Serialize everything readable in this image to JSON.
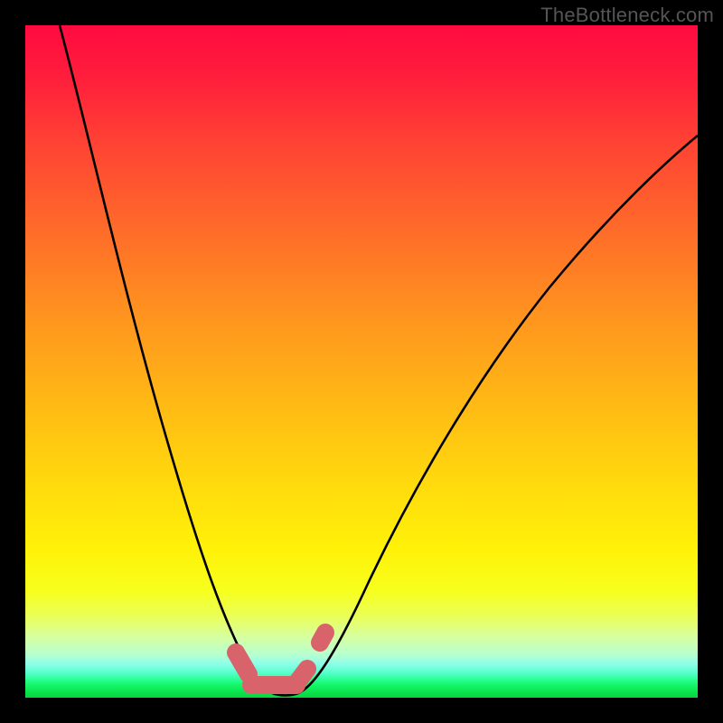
{
  "watermark": {
    "text": "TheBottleneck.com"
  },
  "colors": {
    "frame": "#000000",
    "curve": "#000000",
    "marker": "#d9636b",
    "gradient_top": "#ff0a40",
    "gradient_bottom": "#06d63e"
  },
  "chart_data": {
    "type": "line",
    "title": "",
    "xlabel": "",
    "ylabel": "",
    "xlim": [
      0,
      100
    ],
    "ylim": [
      0,
      100
    ],
    "grid": false,
    "legend": false,
    "note": "V-shaped bottleneck curve; minimum (zero bottleneck) ≈ x 34–40. Values estimated from pixel position (no axis ticks shown).",
    "series": [
      {
        "name": "bottleneck-curve",
        "x": [
          5,
          10,
          15,
          20,
          25,
          28,
          31,
          33,
          35,
          37,
          39,
          41,
          44,
          50,
          55,
          60,
          65,
          70,
          75,
          80,
          85,
          90,
          95,
          100
        ],
        "values": [
          100,
          82,
          64,
          46,
          28,
          17,
          8,
          2,
          0,
          0,
          0,
          2,
          9,
          22,
          32,
          40,
          47,
          53,
          58,
          62,
          66,
          69,
          71,
          73
        ]
      }
    ],
    "markers": {
      "name": "highlighted-near-minimum",
      "x": [
        31.5,
        32.5,
        34,
        36,
        38,
        39.5,
        40.7,
        42.8
      ],
      "values": [
        6.5,
        3.2,
        0.8,
        0,
        0,
        0.8,
        2.6,
        8.4
      ],
      "style": "thick-rounded",
      "color": "#d9636b"
    }
  }
}
